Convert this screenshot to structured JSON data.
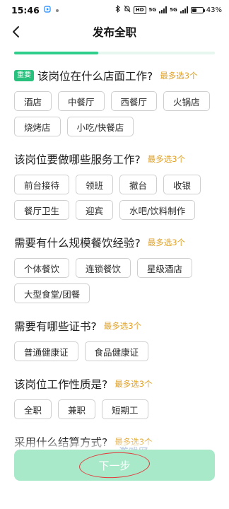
{
  "status_bar": {
    "time": "15:46",
    "badge": "HD",
    "net1": "5G",
    "net2": "5G",
    "battery_text": "43%",
    "battery_level": 0.43
  },
  "nav": {
    "title": "发布全职",
    "back_icon": "chevron-left-icon"
  },
  "progress": {
    "value": 0.42,
    "color": "#2fce8a"
  },
  "sections": [
    {
      "tag": "重要",
      "question": "该岗位在什么店面工作?",
      "hint": "最多选3个",
      "options": [
        "酒店",
        "中餐厅",
        "西餐厅",
        "火锅店",
        "烧烤店",
        "小吃/快餐店"
      ]
    },
    {
      "question": "该岗位要做哪些服务工作?",
      "hint": "最多选3个",
      "options": [
        "前台接待",
        "领班",
        "撤台",
        "收银",
        "餐厅卫生",
        "迎宾",
        "水吧/饮料制作"
      ]
    },
    {
      "question": "需要有什么规模餐饮经验?",
      "hint": "最多选3个",
      "options": [
        "个体餐饮",
        "连锁餐饮",
        "星级酒店",
        "大型食堂/团餐"
      ]
    },
    {
      "question": "需要有哪些证书?",
      "hint": "最多选3个",
      "options": [
        "普通健康证",
        "食品健康证"
      ]
    },
    {
      "question": "该岗位工作性质是?",
      "hint": "最多选3个",
      "options": [
        "全职",
        "兼职",
        "短期工"
      ]
    },
    {
      "question": "采用什么结算方式?",
      "hint": "最多选3个",
      "options": []
    }
  ],
  "footer": {
    "next_label": "下一步",
    "watermark": "游戏网"
  },
  "colors": {
    "accent": "#2fce8a",
    "hint": "#e0a229",
    "button_disabled": "#a8e9ca",
    "annotation_circle": "#e33a3a"
  }
}
